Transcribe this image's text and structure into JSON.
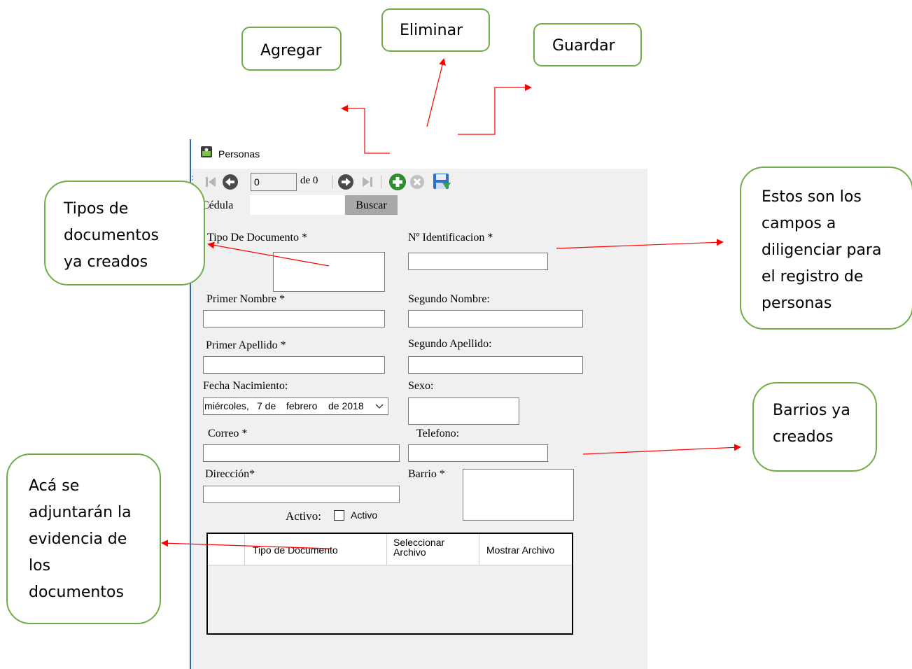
{
  "callouts": {
    "agregar": "Agregar",
    "eliminar": "Eliminar",
    "guardar": "Guardar",
    "tipos_doc": [
      "Tipos de",
      "documentos",
      "ya creados"
    ],
    "campos": [
      "Estos son los",
      "campos a",
      "diligenciar para",
      "el registro de",
      "personas"
    ],
    "barrios": [
      "Barrios ya",
      "creados"
    ],
    "evidencia": [
      "Acá se",
      "adjuntarán la",
      "evidencia de",
      "los",
      "documentos"
    ]
  },
  "window": {
    "title": "Personas",
    "navigator": {
      "position": "0",
      "of_label": "de 0"
    },
    "search": {
      "label": "Cédula",
      "button": "Buscar",
      "value": ""
    },
    "fields": {
      "tipo_documento": "Tipo De Documento *",
      "identificacion": "Nº Identificacion *",
      "primer_nombre": "Primer Nombre *",
      "segundo_nombre": "Segundo Nombre:",
      "primer_apellido": "Primer Apellido *",
      "segundo_apellido": "Segundo Apellido:",
      "fecha_nacimiento": "Fecha Nacimiento:",
      "fecha_value": {
        "weekday": "miércoles,",
        "day": "7 de",
        "month": "febrero",
        "year": "de 2018"
      },
      "sexo": "Sexo:",
      "correo": "Correo *",
      "telefono": "Telefono:",
      "direccion": "Dirección*",
      "barrio": "Barrio *",
      "activo_label": "Activo:",
      "activo_checkbox": "Activo"
    },
    "grid": {
      "columns": [
        "Tipo de Documento",
        "Seleccionar Archivo",
        "Mostrar Archivo"
      ],
      "col2_lines": [
        "Seleccionar",
        "Archivo"
      ]
    }
  },
  "colors": {
    "callout_border": "#70ad47",
    "arrow": "#ff0000",
    "window_bg": "#f0f0f0"
  }
}
